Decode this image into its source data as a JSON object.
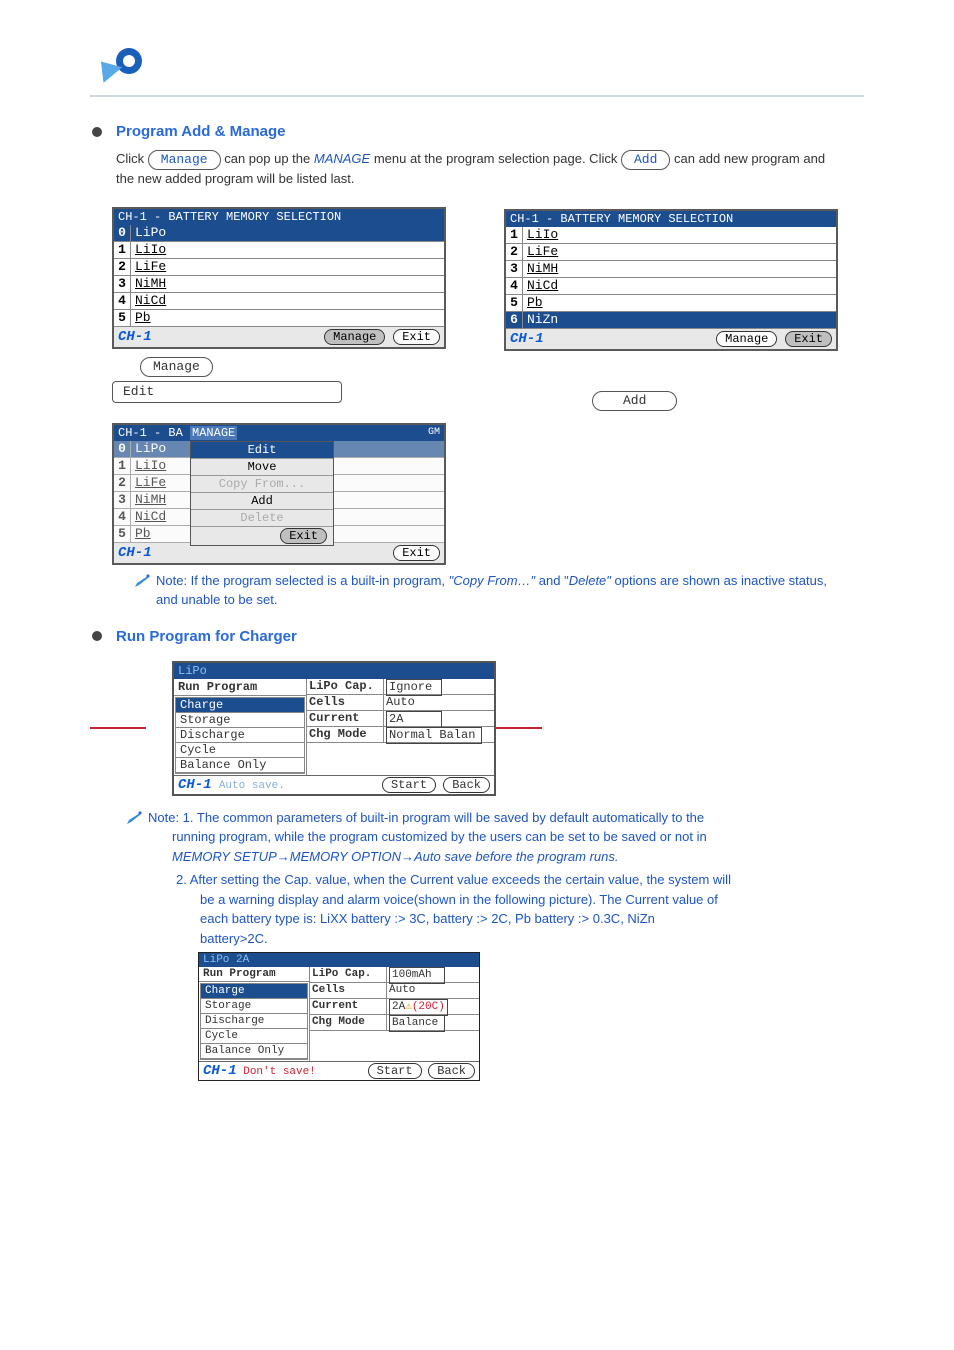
{
  "section1": {
    "title": "Program Add & Manage",
    "intro_plain": "Click ",
    "intro_pill": "Manage",
    "intro_after": " can pop up the ",
    "intro_italic": "MANAGE",
    "intro_after2": " menu at the program selection page. Click ",
    "intro_pill2": "Add",
    "intro_after3": " can add new program and ",
    "intro_plain2": "the new added program will be listed last."
  },
  "shot1": {
    "title": "CH-1 - BATTERY MEMORY SELECTION",
    "items": [
      "LiPo",
      "LiIo",
      "LiFe",
      "NiMH",
      "NiCd",
      "Pb"
    ],
    "ch": "CH-1",
    "manage": "Manage",
    "exit": "Exit"
  },
  "shot2": {
    "title": "CH-1 - BATTERY MEMORY SELECTION",
    "items": [
      "LiIo",
      "LiFe",
      "NiMH",
      "NiCd",
      "Pb",
      "NiZn"
    ],
    "ch": "CH-1",
    "manage": "Manage",
    "exit": "Exit"
  },
  "pill_manage": "Manage",
  "pill_edit": "Edit",
  "pill_add": "Add",
  "manage_popup": {
    "title_left": "CH-1 - BA",
    "title_mid": "MANAGE",
    "title_right": "GM",
    "items": [
      "Edit",
      "Move",
      "Copy From...",
      "Add",
      "Delete"
    ],
    "exit": "Exit",
    "ch": "CH-1",
    "outer_exit": "Exit"
  },
  "note1": "Note: If the program selected is a built-in program, ",
  "note1_copy": "\"Copy From…\"",
  "note1_mid": " and \"",
  "note1_del": "Delete\"",
  "note1_tail": " options are shown as inactive status, and unable to be set.",
  "section2": {
    "title": "Run Program for Charger"
  },
  "prog": {
    "title": "LiPo",
    "run": "Run Program",
    "items": [
      "Charge",
      "Storage",
      "Discharge",
      "Cycle",
      "Balance Only"
    ],
    "cap_l": "LiPo Cap.",
    "cap_v": "Ignore",
    "cells_l": "Cells",
    "cells_v": "Auto",
    "cur_l": "Current",
    "cur_v": "2A",
    "chg_l": "Chg Mode",
    "chg_v": "Normal Balan",
    "ch": "CH-1",
    "auto": "Auto save.",
    "start": "Start",
    "back": "Back"
  },
  "note2_head": "Note: 1. The common parameters of built-in program will be saved by default automatically to the",
  "note2_l2": "running program, while the program customized by the users can be set to be saved or not in ",
  "note2_l3": "MEMORY SETUP→MEMORY OPTION→Auto save before the program runs.",
  "note2_p2a": "2. After setting the Cap. value, when the Current value exceeds the certain value, the system will",
  "note2_p2b": "be a warning display and alarm voice(shown in the following picture). The Current value of",
  "note2_p2c": "each battery type is: LiXX battery :> 3C,                 battery :> 2C, Pb battery :> 0.3C, NiZn",
  "note2_p2d": "battery>2C.",
  "prog2": {
    "title": "LiPo 2A",
    "run": "Run Program",
    "cap_l": "LiPo Cap.",
    "cap_v": "100mAh",
    "cells_l": "Cells",
    "cells_v": "Auto",
    "cur_l": "Current",
    "cur_v": "2A",
    "cur_warn": "(20C)",
    "chg_l": "Chg Mode",
    "chg_v": "Balance",
    "ch": "CH-1",
    "dont": "Don't save!",
    "start": "Start",
    "back": "Back"
  }
}
